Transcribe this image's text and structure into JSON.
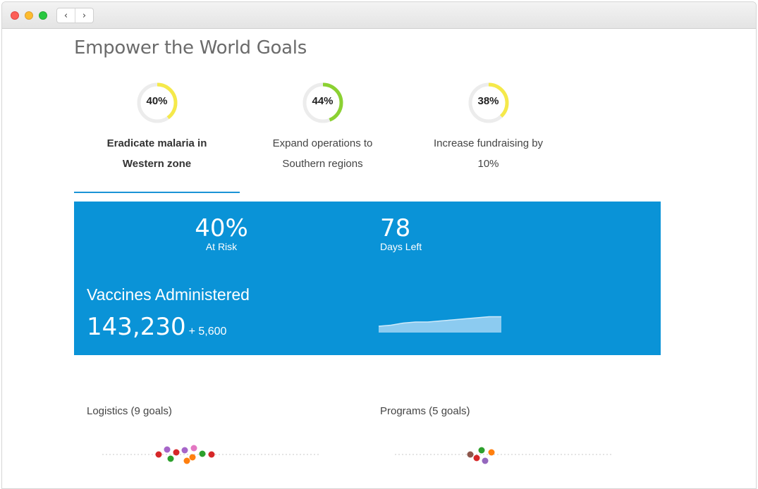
{
  "window": {
    "back_icon": "‹",
    "forward_icon": "›"
  },
  "page_title": "Empower the World Goals",
  "goals": [
    {
      "percent_label": "40%",
      "percent": 40,
      "label": "Eradicate malaria in Western zone",
      "color": "#f5e94a",
      "active": true
    },
    {
      "percent_label": "44%",
      "percent": 44,
      "label": "Expand operations to Southern regions",
      "color": "#8bd132",
      "active": false
    },
    {
      "percent_label": "38%",
      "percent": 38,
      "label": "Increase fundraising by 10%",
      "color": "#f5e94a",
      "active": false
    }
  ],
  "panel": {
    "at_risk_value": "40%",
    "at_risk_label": "At Risk",
    "days_left_value": "78",
    "days_left_label": "Days Left",
    "metric_title": "Vaccines Administered",
    "metric_value": "143,230",
    "metric_delta": "+ 5,600",
    "background_color": "#0a93d7",
    "sparkline": [
      0.3,
      0.35,
      0.45,
      0.5,
      0.5,
      0.55,
      0.6,
      0.65,
      0.7,
      0.75,
      0.75
    ]
  },
  "groups": [
    {
      "label": "Logistics (9 goals)",
      "dot_colors": [
        "#d62728",
        "#a665c9",
        "#2ca02c",
        "#d62728",
        "#a665c9",
        "#e377c2",
        "#ff7f0e",
        "#ff7f0e",
        "#2ca02c",
        "#d62728"
      ]
    },
    {
      "label": "Programs (5 goals)",
      "dot_colors": [
        "#8c564b",
        "#d62728",
        "#2ca02c",
        "#9467bd",
        "#ff7f0e"
      ]
    }
  ]
}
